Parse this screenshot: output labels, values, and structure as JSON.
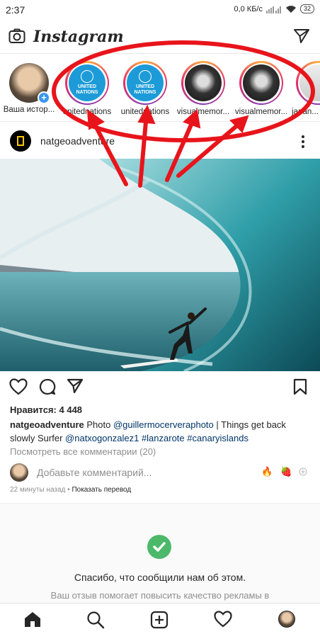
{
  "status": {
    "time": "2:37",
    "network": "0,0 КБ/с",
    "battery": "32"
  },
  "app": {
    "logo": "Instagram"
  },
  "stories": [
    {
      "name": "Ваша истор...",
      "type": "own"
    },
    {
      "name": "unitednations",
      "type": "un",
      "logo_text_1": "UNITED",
      "logo_text_2": "NATIONS"
    },
    {
      "name": "unitednations",
      "type": "un",
      "logo_text_1": "UNITED",
      "logo_text_2": "NATIONS"
    },
    {
      "name": "visualmemor...",
      "type": "dark"
    },
    {
      "name": "visualmemor...",
      "type": "dark"
    },
    {
      "name": "japan...",
      "type": "japan"
    }
  ],
  "post": {
    "user": "natgeoadventure",
    "likes": "Нравится: 4 448",
    "caption_user": "natgeoadventure",
    "caption_text_1": " Photo ",
    "caption_mention_1": "@guillermocerveraphoto",
    "caption_text_2": " | Things get back slowly Surfer ",
    "caption_mention_2": "@natxogonzalez1",
    "caption_text_3": " ",
    "caption_tag_1": "#lanzarote",
    "caption_text_4": " ",
    "caption_tag_2": "#canaryislands",
    "view_comments": "Посмотреть все комментарии (20)",
    "comment_placeholder": "Добавьте комментарий...",
    "timestamp": "22 минуты назад",
    "separator": " • ",
    "translate": "Показать перевод",
    "emojis": [
      "🔥",
      "🍓"
    ]
  },
  "feedback": {
    "thanks": "Спасибо, что сообщили нам об этом.",
    "sub": "Ваш отзыв помогает повысить качество рекламы в"
  },
  "colors": {
    "annotation": "#e8141b",
    "link": "#003569",
    "accent": "#3897f0",
    "check": "#4cb86a"
  },
  "icons": {
    "camera": "camera-icon",
    "direct": "paper-plane-icon",
    "like": "heart-icon",
    "comment": "comment-bubble-icon",
    "share": "paper-plane-icon",
    "save": "bookmark-icon",
    "more": "vertical-dots-icon",
    "home": "home-icon",
    "search": "search-icon",
    "add": "plus-square-icon",
    "activity": "heart-icon"
  }
}
